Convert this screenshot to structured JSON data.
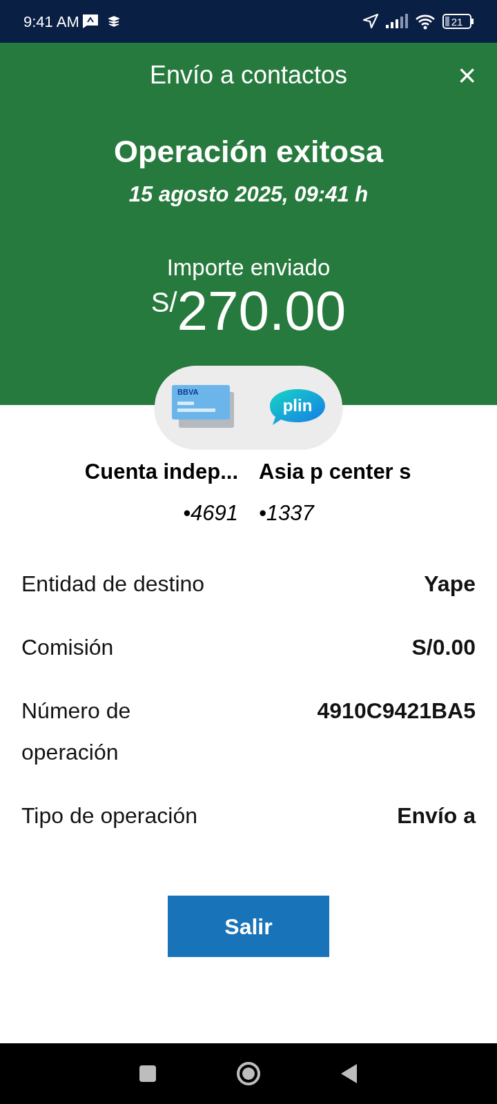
{
  "status_bar": {
    "time": "9:41 AM",
    "battery": "21"
  },
  "header": {
    "title": "Envío a contactos",
    "close": "×",
    "result": "Operación exitosa",
    "datetime": "15 agosto 2025, 09:41 h",
    "amount_label": "Importe enviado",
    "currency": "S/",
    "amount": "270.00"
  },
  "transfer": {
    "source_logo_text": "BBVA",
    "destination_logo_text": "plin",
    "source_name": "Cuenta indep...",
    "source_account": "•4691",
    "destination_name": "Asia p center s",
    "destination_account": "•1337"
  },
  "details": [
    {
      "label": "Entidad de destino",
      "value": "Yape"
    },
    {
      "label": "Comisión",
      "value": "S/0.00"
    },
    {
      "label": "Número de operación",
      "value": "4910C9421BA5"
    },
    {
      "label": "Tipo de operación",
      "value": "Envío a"
    }
  ],
  "exit_button": "Salir"
}
